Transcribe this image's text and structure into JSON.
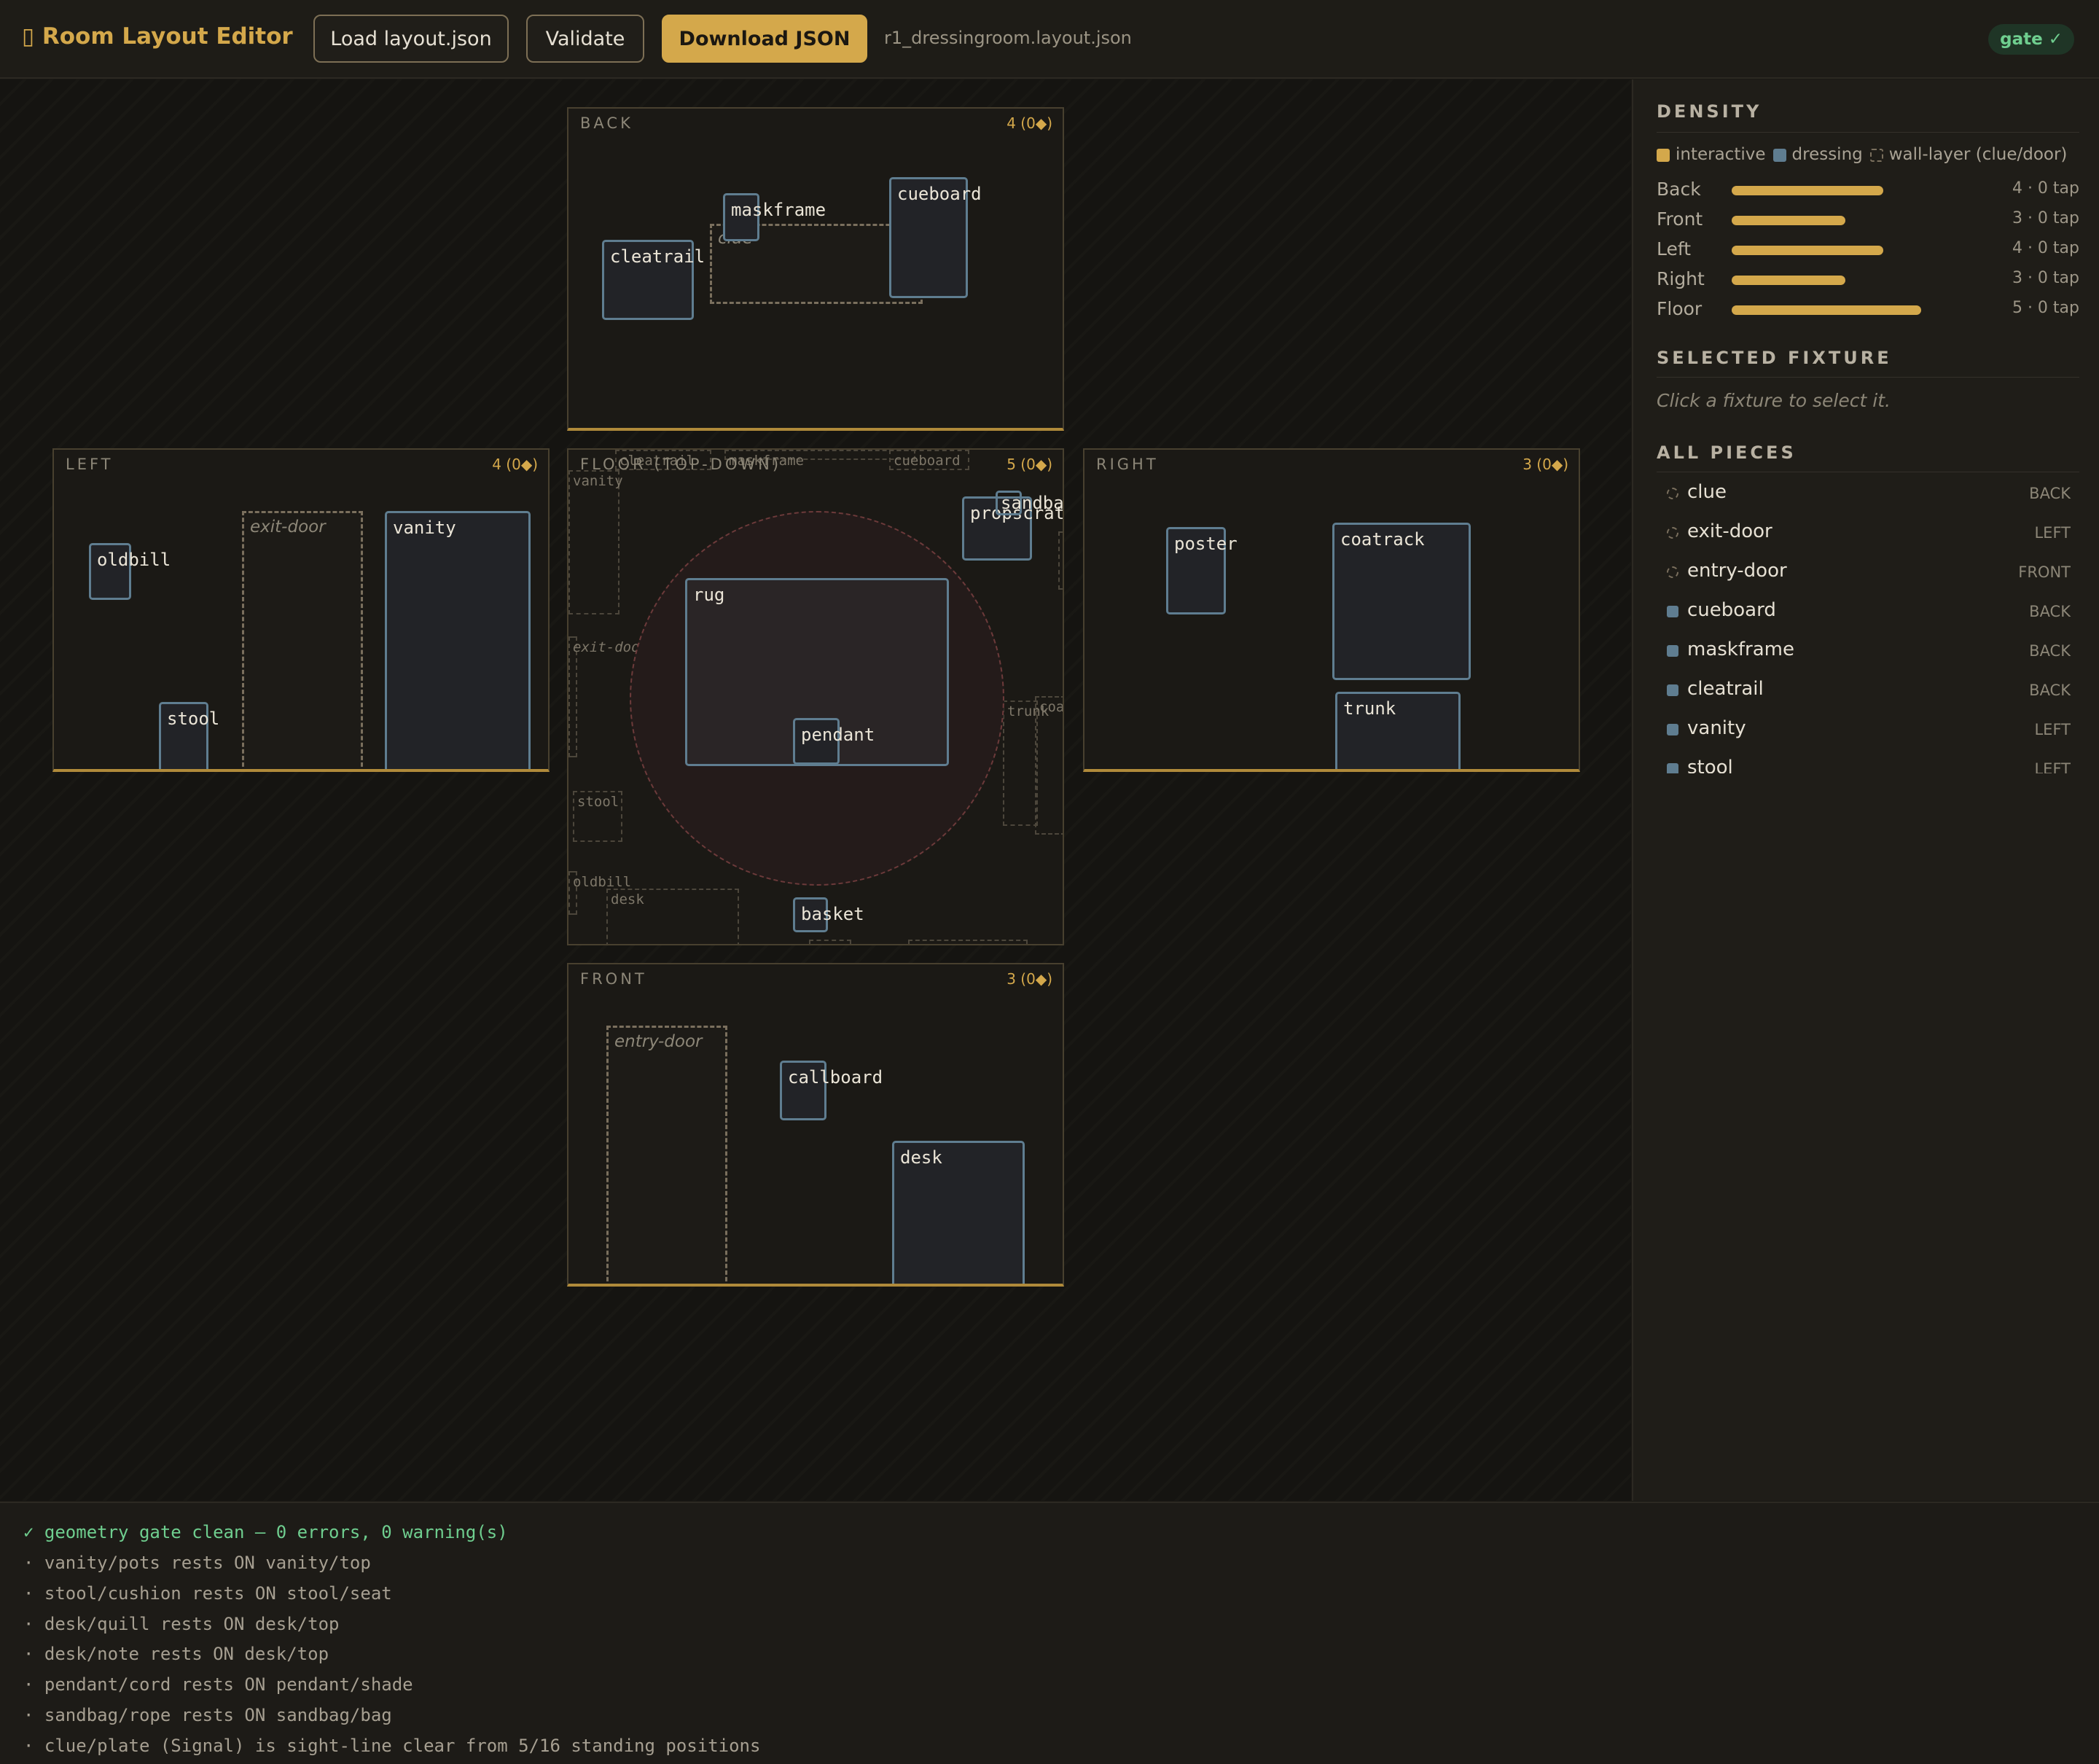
{
  "toolbar": {
    "app_title": "▯ Room Layout Editor",
    "load_label": "Load layout.json",
    "validate_label": "Validate",
    "download_label": "Download JSON",
    "filename": "r1_dressingroom.layout.json",
    "gate_badge": "gate ✓"
  },
  "faces": {
    "back": {
      "label": "BACK",
      "count": "4 (0◆)",
      "fixtures": [
        "cleatrail",
        "maskframe",
        "cueboard"
      ],
      "wall": "clue"
    },
    "left": {
      "label": "LEFT",
      "count": "4 (0◆)",
      "fixtures": [
        "oldbill",
        "stool",
        "vanity"
      ],
      "wall": "exit-door"
    },
    "floor": {
      "label": "FLOOR (TOP-DOWN)",
      "count": "5 (0◆)",
      "fixtures": [
        "rug",
        "pendant",
        "propscrate",
        "sandbag",
        "basket"
      ],
      "ghosts": [
        "cleatrail",
        "maskframe",
        "cueboard",
        "vanity",
        "exit-door",
        "stool",
        "oldbill",
        "desk",
        "trunk",
        "coatrack"
      ]
    },
    "right": {
      "label": "RIGHT",
      "count": "3 (0◆)",
      "fixtures": [
        "poster",
        "coatrack",
        "trunk"
      ]
    },
    "front": {
      "label": "FRONT",
      "count": "3 (0◆)",
      "fixtures": [
        "callboard",
        "desk"
      ],
      "wall": "entry-door"
    }
  },
  "sidebar": {
    "density_title": "DENSITY",
    "legend": {
      "interactive": "interactive",
      "dressing": "dressing",
      "wall": "wall-layer (clue/door)"
    },
    "density": [
      {
        "name": "Back",
        "value": "4 · 0 tap",
        "fill": 4
      },
      {
        "name": "Front",
        "value": "3 · 0 tap",
        "fill": 3
      },
      {
        "name": "Left",
        "value": "4 · 0 tap",
        "fill": 4
      },
      {
        "name": "Right",
        "value": "3 · 0 tap",
        "fill": 3
      },
      {
        "name": "Floor",
        "value": "5 · 0 tap",
        "fill": 5
      }
    ],
    "selected_title": "SELECTED FIXTURE",
    "selected_empty": "Click a fixture to select it.",
    "pieces_title": "ALL PIECES",
    "pieces": [
      {
        "name": "clue",
        "face": "BACK",
        "kind": "wall"
      },
      {
        "name": "exit-door",
        "face": "LEFT",
        "kind": "wall"
      },
      {
        "name": "entry-door",
        "face": "FRONT",
        "kind": "wall"
      },
      {
        "name": "cueboard",
        "face": "BACK",
        "kind": "dressing"
      },
      {
        "name": "maskframe",
        "face": "BACK",
        "kind": "dressing"
      },
      {
        "name": "cleatrail",
        "face": "BACK",
        "kind": "dressing"
      },
      {
        "name": "vanity",
        "face": "LEFT",
        "kind": "dressing"
      },
      {
        "name": "stool",
        "face": "LEFT",
        "kind": "dressing"
      }
    ]
  },
  "colors": {
    "accent": "#d4a84b",
    "interactive": "#d4a84b",
    "dressing": "#5f7d90",
    "gate_ok": "#6fce8f"
  },
  "console": {
    "lines": [
      "✓ geometry gate clean — 0 errors, 0 warning(s)",
      "· vanity/pots rests ON vanity/top",
      "· stool/cushion rests ON stool/seat",
      "· desk/quill rests ON desk/top",
      "· desk/note rests ON desk/top",
      "· pendant/cord rests ON pendant/shade",
      "· sandbag/rope rests ON sandbag/bag",
      "· clue/plate (Signal) is sight-line clear from 5/16 standing positions"
    ]
  }
}
